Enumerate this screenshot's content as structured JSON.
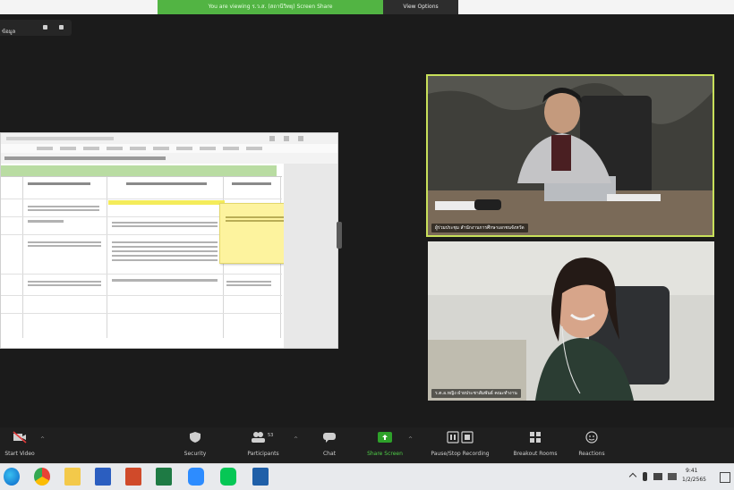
{
  "banner": {
    "sharing_text": "You are viewing ร.ว.ส. (สถานีวิทยุ) Screen Share",
    "view_options": "View Options"
  },
  "meeting": {
    "id_label": "ข้อมูล"
  },
  "participants": [
    {
      "name": "ผู้ร่วมประชุม สำนักงานการศึกษาเอกชนจังหวัด"
    },
    {
      "name": "ร.ต.อ.หญิง ฝ่ายประชาสัมพันธ์ คณะทำงาน"
    }
  ],
  "toolbar": {
    "buttons": [
      {
        "label": "Start Video",
        "icon": "video-off-icon"
      },
      {
        "label": "Security",
        "icon": "shield-icon"
      },
      {
        "label": "Participants",
        "icon": "participants-icon",
        "count": "53"
      },
      {
        "label": "Chat",
        "icon": "chat-icon"
      },
      {
        "label": "Share Screen",
        "icon": "share-screen-icon"
      },
      {
        "label": "Pause/Stop Recording",
        "icon": "recording-icon"
      },
      {
        "label": "Breakout Rooms",
        "icon": "breakout-rooms-icon"
      },
      {
        "label": "Reactions",
        "icon": "reactions-icon"
      }
    ]
  },
  "taskbar": {
    "apps": [
      "edge-icon",
      "chrome-icon",
      "file-explorer-icon",
      "word-icon",
      "powerpoint-icon",
      "excel-icon",
      "zoom-icon",
      "line-icon",
      "photos-icon"
    ],
    "time": "9:41",
    "date": "1/2/2565"
  },
  "colors": {
    "accent_green": "#52b443",
    "active_speaker_border": "#c8e05a",
    "note_yellow": "#fdf39e"
  }
}
